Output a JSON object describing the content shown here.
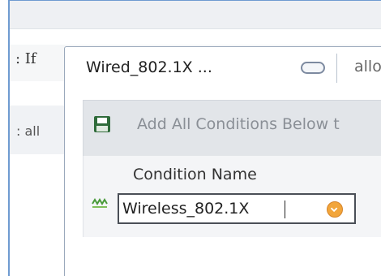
{
  "policy": {
    "if_label": ": If",
    "continuation_label": ":  all"
  },
  "condition_popup": {
    "title": "Wired_802.1X ...",
    "next_field_partial": "allo",
    "toolbar": {
      "add_all_label": "Add All Conditions Below t"
    },
    "conditions": {
      "header": "Condition Name",
      "name_value": "Wireless_802.1X"
    }
  },
  "colors": {
    "panel_border": "#6f9bd1",
    "dropdown_accent": "#f2a53a",
    "save_icon": "#2f6b3a"
  }
}
